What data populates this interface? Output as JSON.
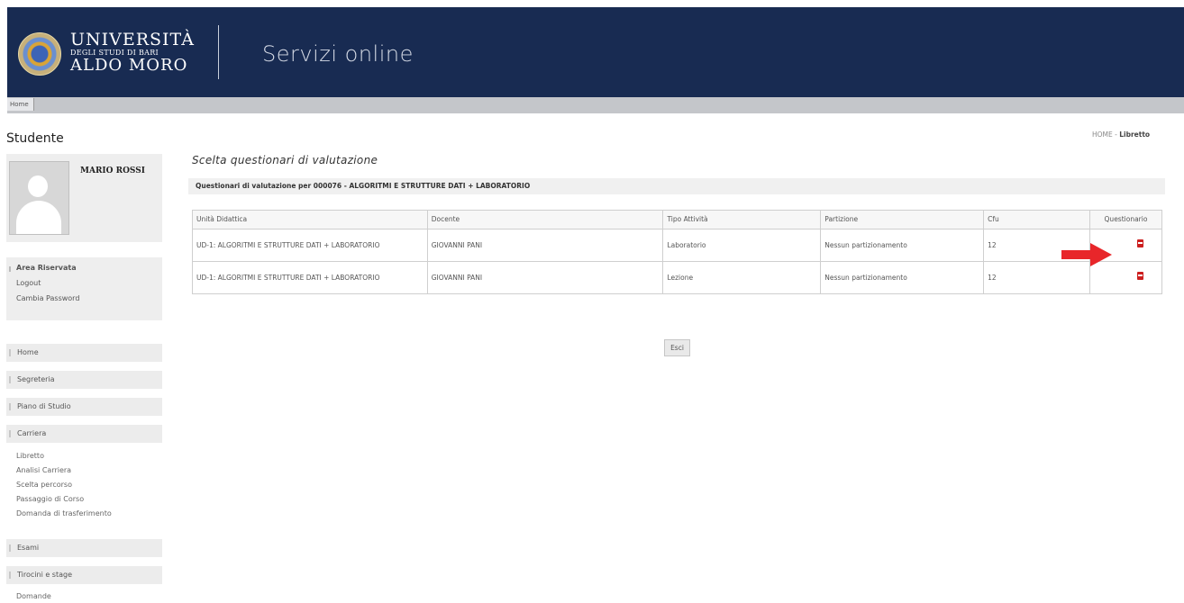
{
  "header": {
    "logo_line1": "UNIVERSITÀ",
    "logo_line2": "DEGLI STUDI DI BARI",
    "logo_line3": "ALDO MORO",
    "title": "Servizi online"
  },
  "navbar": {
    "home": "Home"
  },
  "sidebar": {
    "title": "Studente",
    "profile_name": "MARIO ROSSI",
    "reserved": {
      "heading": "Area Riservata",
      "items": [
        "Logout",
        "Cambia Password"
      ]
    },
    "menu": [
      "Home",
      "Segreteria",
      "Piano di Studio",
      "Carriera"
    ],
    "carriera_items": [
      "Libretto",
      "Analisi Carriera",
      "Scelta percorso",
      "Passaggio di Corso",
      "Domanda di trasferimento"
    ],
    "menu2": [
      "Esami",
      "Tirocini e stage"
    ],
    "tail_item": "Domande"
  },
  "breadcrumb": {
    "home": "HOME",
    "separator": " - ",
    "current": "Libretto"
  },
  "main": {
    "title": "Scelta questionari di valutazione",
    "subtitle": "Questionari di valutazione per 000076 - ALGORITMI E STRUTTURE DATI + LABORATORIO",
    "columns": [
      "Unità Didattica",
      "Docente",
      "Tipo Attività",
      "Partizione",
      "Cfu",
      "Questionario"
    ],
    "rows": [
      {
        "unit": "UD-1: ALGORITMI E STRUTTURE DATI + LABORATORIO",
        "teacher": "GIOVANNI PANI",
        "type": "Laboratorio",
        "partition": "Nessun partizionamento",
        "cfu": "12"
      },
      {
        "unit": "UD-1: ALGORITMI E STRUTTURE DATI + LABORATORIO",
        "teacher": "GIOVANNI PANI",
        "type": "Lezione",
        "partition": "Nessun partizionamento",
        "cfu": "12"
      }
    ],
    "exit_label": "Esci"
  },
  "colors": {
    "header_bg": "#182b52",
    "navbar_bg": "#c4c6ca",
    "sidebar_bg": "#ececec",
    "pdf_icon": "#cc1f1f",
    "arrow": "#e8262a"
  },
  "icons": [
    "university-seal-icon",
    "avatar-placeholder-icon",
    "pdf-icon",
    "red-arrow-icon"
  ]
}
